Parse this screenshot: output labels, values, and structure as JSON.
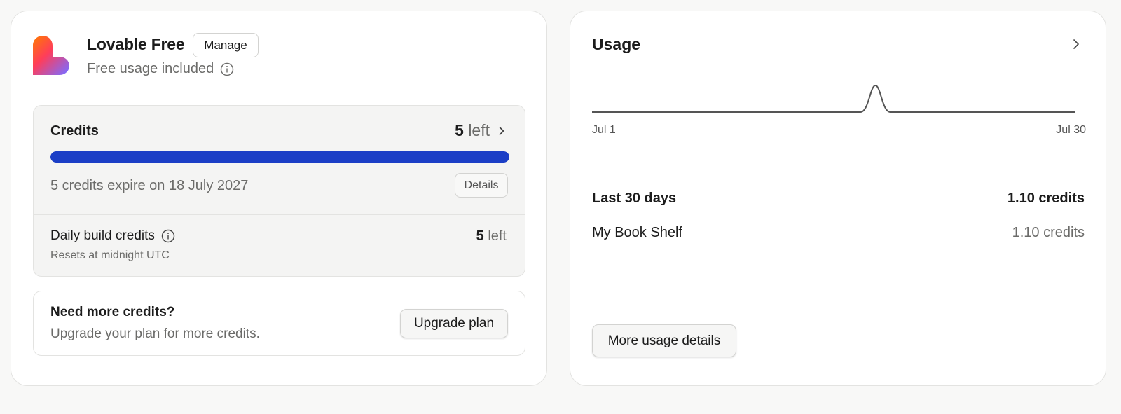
{
  "plan": {
    "name": "Lovable Free",
    "manage_label": "Manage",
    "subtitle": "Free usage included",
    "logo_icon": "lovable-heart-logo",
    "info_icon": "info-circle-icon"
  },
  "credits": {
    "title": "Credits",
    "remaining": "5",
    "remaining_suffix": "left",
    "progress_fraction": 1.0,
    "bar_color": "#1b3ec6",
    "expire_text": "5 credits expire on 18 July 2027",
    "details_label": "Details",
    "daily": {
      "title": "Daily build credits",
      "subtitle": "Resets at midnight UTC",
      "remaining": "5",
      "remaining_suffix": "left"
    }
  },
  "upgrade": {
    "title": "Need more credits?",
    "subtitle": "Upgrade your plan for more credits.",
    "button_label": "Upgrade plan"
  },
  "usage": {
    "title": "Usage",
    "chart": {
      "type": "line",
      "x_start_label": "Jul 1",
      "x_end_label": "Jul 30",
      "days": 30,
      "peak_day": 18,
      "peak_value": 1.1,
      "line_color": "#555555"
    },
    "period_label": "Last 30 days",
    "period_total": "1.10 credits",
    "projects": [
      {
        "name": "My Book Shelf",
        "value": "1.10 credits"
      }
    ],
    "more_label": "More usage details"
  }
}
